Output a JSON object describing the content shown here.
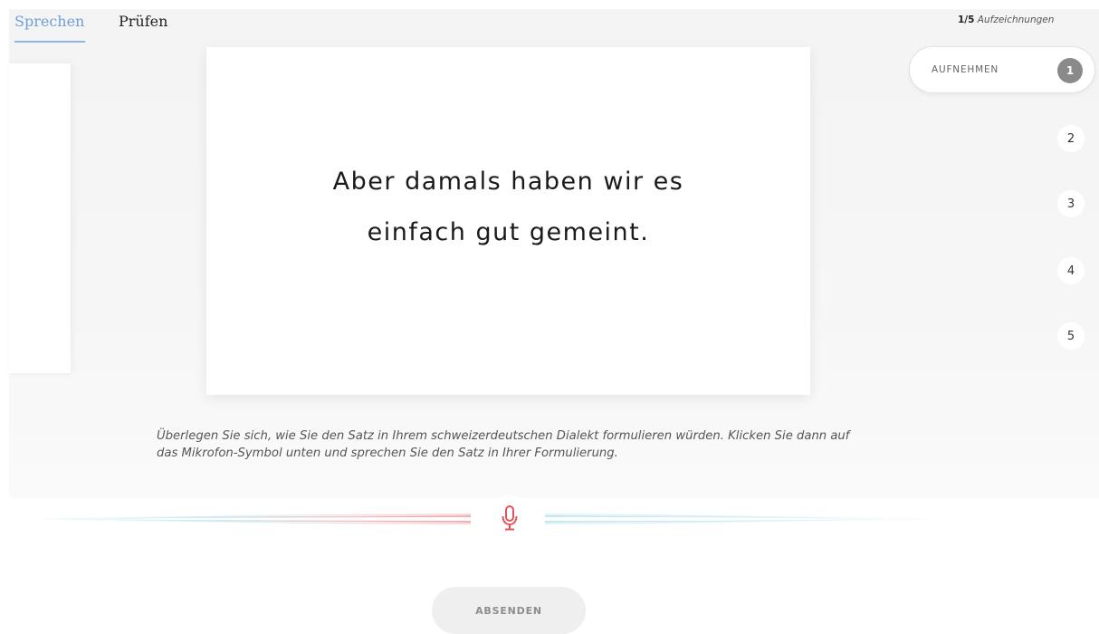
{
  "tabs": [
    {
      "label": "Sprechen",
      "active": true
    },
    {
      "label": "Prüfen",
      "active": false
    }
  ],
  "counter": {
    "count": "1/5",
    "label": "Aufzeichnungen"
  },
  "sentence": {
    "line1": "Aber damals haben wir es",
    "line2": "einfach gut gemeint."
  },
  "steps": {
    "active": {
      "label": "AUFNEHMEN",
      "number": "1"
    },
    "others": [
      "2",
      "3",
      "4",
      "5"
    ]
  },
  "instructions": "Überlegen Sie sich, wie Sie den Satz in Ihrem schweizerdeutschen Dialekt formulieren würden. Klicken Sie dann auf das Mikrofon-Symbol unten und sprechen Sie den Satz in Ihrer Formulierung.",
  "mic": {
    "icon": "microphone-icon"
  },
  "submit": {
    "label": "ABSENDEN"
  },
  "colors": {
    "accent_blue": "#6f9fd8",
    "mic_red": "#e2545c",
    "wave_cyan": "#bfe6ee",
    "wave_pink": "#f4b9bd"
  }
}
